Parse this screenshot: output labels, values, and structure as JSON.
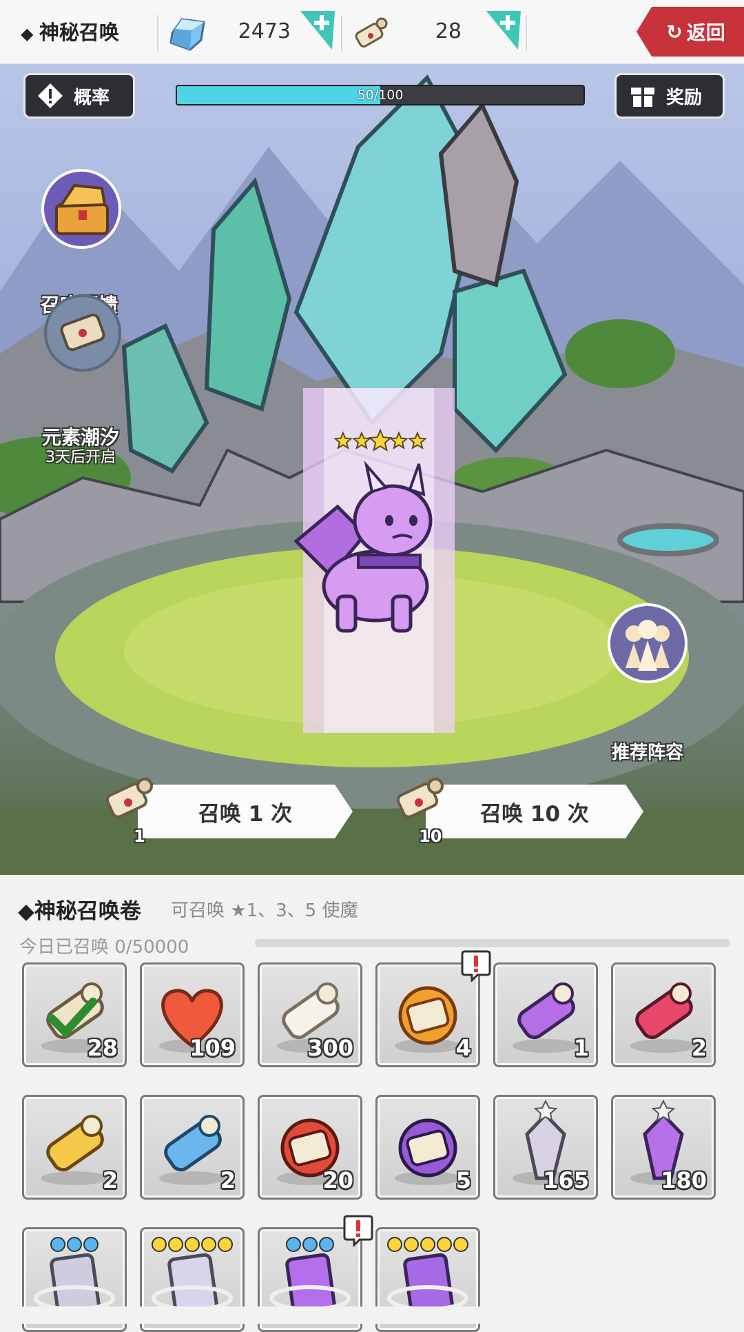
{
  "topbar": {
    "title": "神秘召唤",
    "crystal": {
      "icon": "blue-crystal-icon",
      "value": "2473"
    },
    "scroll": {
      "icon": "summon-scroll-icon",
      "value": "28"
    },
    "back_label": "返回"
  },
  "scene": {
    "rates_label": "概率",
    "rewards_label": "奖励",
    "progress": {
      "text": "50/100",
      "fraction": 0.5
    },
    "feedback_label": "召唤回馈",
    "event": {
      "label": "元素潮汐",
      "sub": "3天后开启"
    },
    "recommend_label": "推荐阵容",
    "hero_stars": 5,
    "summon_one": {
      "label": "召唤 1 次",
      "cost": "1"
    },
    "summon_ten": {
      "label": "召唤 10 次",
      "cost": "10"
    }
  },
  "inventory": {
    "title": "◆神秘召唤卷",
    "subtitle": "可召唤 ★1、3、5 使魔",
    "daily": "今日已召唤 0/50000",
    "items": [
      {
        "name": "checked-scroll",
        "qty": "28"
      },
      {
        "name": "red-heart",
        "qty": "109"
      },
      {
        "name": "paper-scroll",
        "qty": "300"
      },
      {
        "name": "golden-scroll-bundle",
        "qty": "4",
        "alert": true
      },
      {
        "name": "purple-scroll",
        "qty": "1"
      },
      {
        "name": "red-scroll",
        "qty": "2"
      },
      {
        "name": "yellow-scroll",
        "qty": "2"
      },
      {
        "name": "blue-scroll",
        "qty": "2"
      },
      {
        "name": "red-scroll-bundle",
        "qty": "20"
      },
      {
        "name": "purple-scroll-bundle",
        "qty": "5"
      },
      {
        "name": "silver-shard",
        "qty": "165"
      },
      {
        "name": "purple-shard",
        "qty": "180"
      },
      {
        "name": "silver-card-3star",
        "qty": ""
      },
      {
        "name": "silver-card-5star",
        "qty": ""
      },
      {
        "name": "purple-card-3star",
        "qty": "",
        "alert": true
      },
      {
        "name": "purple-card-5star",
        "qty": ""
      }
    ]
  },
  "colors": {
    "accent_red": "#c8323a",
    "progress_fill": "#4ed4e4",
    "teal_plus": "#3ec7b8",
    "hud_dark": "#2d2f35"
  }
}
